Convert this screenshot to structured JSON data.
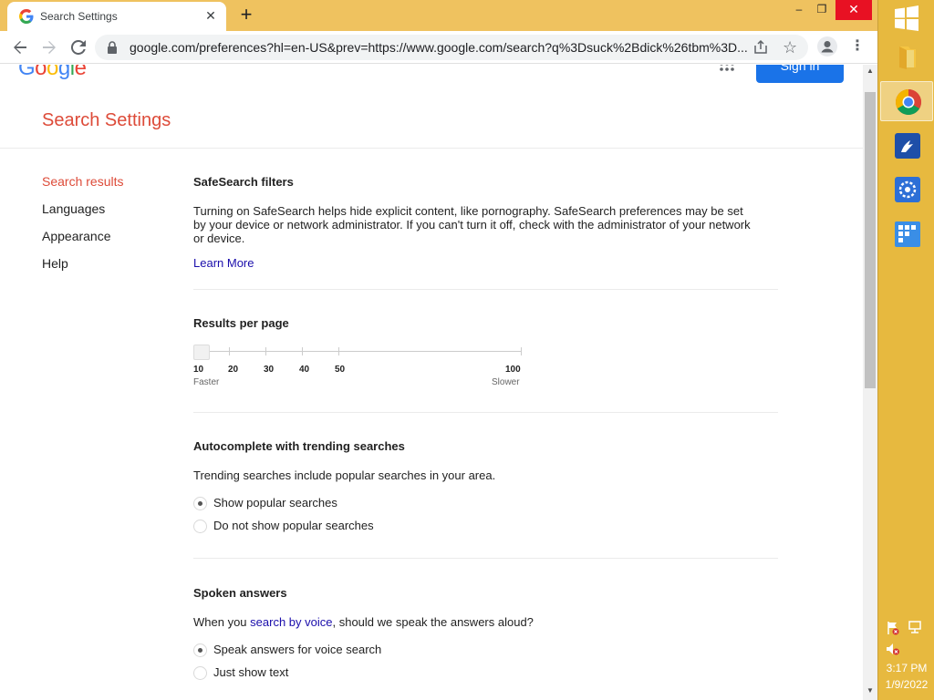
{
  "browser": {
    "tab_title": "Search Settings",
    "tab_close": "✕",
    "new_tab": "+",
    "window": {
      "minimize": "–",
      "maximize": "❐",
      "close": "✕"
    },
    "url": "google.com/preferences?hl=en-US&prev=https://www.google.com/search?q%3Dsuck%2Bdick%26tbm%3D...",
    "icons": [
      "back-icon",
      "forward-icon",
      "reload-icon",
      "lock-icon",
      "share-icon",
      "star-icon",
      "profile-icon",
      "menu-icon"
    ]
  },
  "header": {
    "logo": "Google",
    "signin_label": "Sign in",
    "page_title": "Search Settings"
  },
  "sidebar": {
    "items": [
      {
        "label": "Search results",
        "active": true
      },
      {
        "label": "Languages",
        "active": false
      },
      {
        "label": "Appearance",
        "active": false
      },
      {
        "label": "Help",
        "active": false
      }
    ]
  },
  "safesearch": {
    "heading": "SafeSearch filters",
    "description": "Turning on SafeSearch helps hide explicit content, like pornography. SafeSearch preferences may be set by your device or network administrator. If you can't turn it off, check with the administrator of your network or device.",
    "learn_more": "Learn More"
  },
  "results_per_page": {
    "heading": "Results per page",
    "selected": 10,
    "ticks": [
      "10",
      "20",
      "30",
      "40",
      "50",
      "100"
    ],
    "faster": "Faster",
    "slower": "Slower"
  },
  "autocomplete": {
    "heading": "Autocomplete with trending searches",
    "description": "Trending searches include popular searches in your area.",
    "options": [
      {
        "label": "Show popular searches",
        "checked": true
      },
      {
        "label": "Do not show popular searches",
        "checked": false
      }
    ]
  },
  "spoken_answers": {
    "heading": "Spoken answers",
    "description_prefix": "When you ",
    "description_link": "search by voice",
    "description_suffix": ", should we speak the answers aloud?",
    "options": [
      {
        "label": "Speak answers for voice search",
        "checked": true
      },
      {
        "label": "Just show text",
        "checked": false
      }
    ]
  },
  "taskbar": {
    "apps": [
      "file-explorer",
      "chrome",
      "app-blue",
      "app-settings",
      "app-grid"
    ],
    "time": "3:17 PM",
    "date": "1/9/2022"
  },
  "colors": {
    "accent_red": "#dd4b39",
    "link_blue": "#1a0dab",
    "button_blue": "#1a73e8",
    "titlebar": "#efc25f",
    "taskbar": "#e7b93f"
  }
}
